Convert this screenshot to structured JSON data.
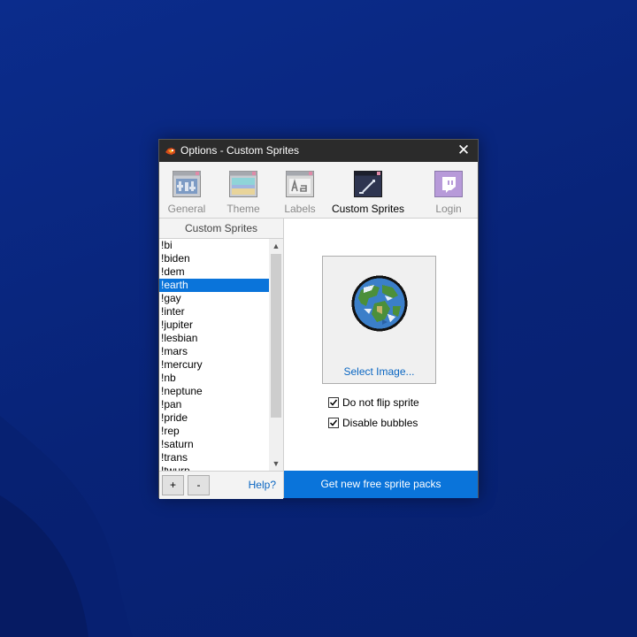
{
  "window": {
    "title": "Options - Custom Sprites",
    "close_glyph": "✕"
  },
  "toolbar": {
    "tabs": [
      {
        "label": "General",
        "icon": "general-icon"
      },
      {
        "label": "Theme",
        "icon": "theme-icon"
      },
      {
        "label": "Labels",
        "icon": "labels-icon"
      },
      {
        "label": "Custom Sprites",
        "icon": "custom-sprites-icon",
        "active": true
      },
      {
        "label": "Login",
        "icon": "twitch-icon"
      }
    ]
  },
  "sprites_list": {
    "header": "Custom Sprites",
    "items": [
      "!bi",
      "!biden",
      "!dem",
      "!earth",
      "!gay",
      "!inter",
      "!jupiter",
      "!lesbian",
      "!mars",
      "!mercury",
      "!nb",
      "!neptune",
      "!pan",
      "!pride",
      "!rep",
      "!saturn",
      "!trans",
      "!twurp"
    ],
    "selected": "!earth",
    "add_label": "+",
    "remove_label": "-",
    "help_label": "Help?"
  },
  "sprite_preview": {
    "select_image_label": "Select Image...",
    "do_not_flip_label": "Do not flip sprite",
    "do_not_flip_checked": true,
    "disable_bubbles_label": "Disable bubbles",
    "disable_bubbles_checked": true
  },
  "get_packs_label": "Get new free sprite packs",
  "colors": {
    "accent": "#0a74da",
    "titlebar": "#2b2b2b",
    "desktop": "#0a2a8a"
  }
}
